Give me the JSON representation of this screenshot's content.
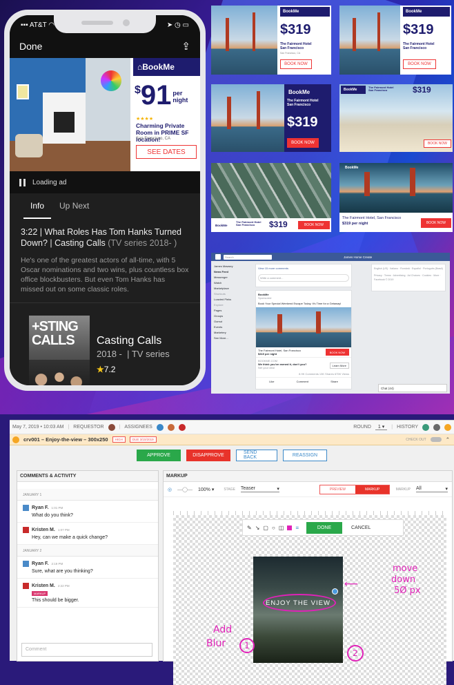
{
  "phone": {
    "carrier": "AT&T",
    "done": "Done",
    "ad": {
      "brand": "BookMe",
      "currency": "$",
      "price": "91",
      "per": "per",
      "night": "night",
      "title": "Charming Private Room in PRIME SF location!",
      "location": "San Francisco, CA",
      "button": "SEE DATES"
    },
    "loading": "Loading ad",
    "tabs": [
      "Info",
      "Up Next"
    ],
    "video_title": "3:22 | What Roles Has Tom Hanks Turned Down? | Casting Calls",
    "video_sub": "(TV series 2018- )",
    "description": "He's one of the greatest actors of all-time, with 5 Oscar nominations and two wins, plus countless box office blockbusters. But even Tom Hanks has missed out on some classic roles.",
    "poster_text": "+STING CALLS",
    "show_title": "Casting Calls",
    "show_years": "2018 -",
    "show_type": "TV series",
    "rating": "7.2"
  },
  "ads": {
    "brand": "BookMe",
    "price": "$319",
    "per": "per",
    "night": "night",
    "hotel": "The Fairmont Hotel",
    "city": "San Francisco",
    "city_state": "San Francisco, CA",
    "hotel_line": "The Fairmont Hotel, San Francisco",
    "price_line": "$319 per night",
    "book": "BOOK NOW"
  },
  "facebook": {
    "search": "Search",
    "nav": "James  Home  Create",
    "left_items": [
      "James Mawsey",
      "News Feed",
      "Messenger",
      "Watch",
      "Marketplace",
      "Shortcuts",
      "Loacted Pieks",
      "Explore",
      "Pages",
      "Groups",
      "Oomut",
      "Events",
      "Marketery",
      "See More..."
    ],
    "compose": "Write a comment...",
    "view_more": "View 15 more comments",
    "poster": "BookMe",
    "sponsored": "Sponsored",
    "post_text": "Book Your Special Weekend Escape Today. It's Time for a Getaway!",
    "ad_title": "The Fairmont Hotel, San Francisco",
    "ad_price": "$319 per night",
    "book": "BOOK NOW",
    "domain": "BOOKME.COM",
    "cta_text": "We think you've earned it, don't you?",
    "cta_sub": "Net your deal",
    "learn": "Learn More",
    "stats": "8.9K Comments  13K Shares  675K Views",
    "actions": [
      "Like",
      "Comment",
      "Share"
    ],
    "langs": "English (US) · Italiano · Română · Español · Português (Brasil)",
    "footer": "Privacy · Terms · Advertising · Ad Choices · Cookies · More · Facebook © 2019",
    "chat": "Chat (44)"
  },
  "tool": {
    "date": "May 7, 2019 • 10:03 AM",
    "requestor": "REQUESTOR",
    "assignees": "ASSIGNEES",
    "round_label": "ROUND",
    "round": "1",
    "history": "HISTORY",
    "file": "crv001 – Enjoy-the-view – 300x250",
    "tag_high": "HIGH",
    "tag_due": "DUE 3/10/2019",
    "checkout": "CHECK OUT",
    "buttons": {
      "approve": "APPROVE",
      "disapprove": "DISAPPROVE",
      "send_back": "SEND BACK",
      "reassign": "REASSIGN"
    },
    "comments_header": "COMMENTS & ACTIVITY",
    "markup_header": "MARKUP",
    "zoom": "100%",
    "stage_label": "STAGE",
    "stage": "Teaser",
    "preview": "PREVIEW",
    "markup": "MARKUP",
    "markup_filter_label": "MARKUP",
    "markup_filter": "All",
    "done": "DONE",
    "cancel": "CANCEL",
    "days": [
      "JANUARY 1",
      "JANUARY 2"
    ],
    "comments": [
      {
        "name": "Ryan F.",
        "time": "1:01 PM",
        "text": "What do you think?"
      },
      {
        "name": "Kristen M.",
        "time": "1:07 PM",
        "text": "Hey, can we make a quick change?"
      },
      {
        "name": "Ryan F.",
        "time": "2:19 PM",
        "text": "Sure, what are you thinking?"
      },
      {
        "name": "Kristen M.",
        "time": "2:22 PM",
        "tag": "MARKUP",
        "text": "This should be bigger."
      }
    ],
    "comment_placeholder": "Comment",
    "creative_text": "ENJOY THE VIEW",
    "annotations": {
      "add": "Add",
      "blur": "Blur",
      "move": "move",
      "down": "down",
      "px": "5Ø px",
      "n1": "1",
      "n2": "2"
    }
  }
}
